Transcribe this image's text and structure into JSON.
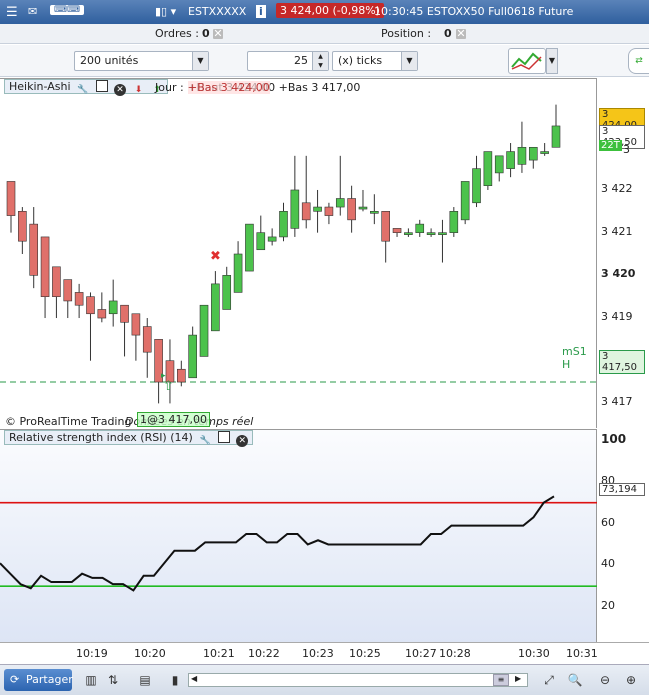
{
  "titlebar": {
    "instrument": "ESTXXXXX",
    "price_badge": "3 424,00 (-0,98%)",
    "info": "10:30:45 ESTOXX50 Full0618 Future",
    "info_icon": "i"
  },
  "ordersbar": {
    "orders_label": "Ordres :",
    "orders_value": "0",
    "position_label": "Position :",
    "position_value": "0"
  },
  "toolbar": {
    "quantity_select": "200 unités",
    "tick_value": "25",
    "tick_unit_select": "(x) ticks"
  },
  "price_panel": {
    "title": "Heikin-Ashi",
    "info_text": "Jour : +Haut 3 424,00 +Bas 3 417,00",
    "info_overlay": "+Bas 3 424,00",
    "copyright": "© ProRealTime Trading",
    "realtime": "Données en temps réel",
    "fill_label": "1@3 417,00",
    "ms1_label": "mS1 H",
    "axis_ticks": [
      "3 422",
      "3 421",
      "3 420",
      "3 419",
      "3 418",
      "3 417"
    ],
    "axis_tick_values": [
      3422,
      3421,
      3420,
      3419,
      3418,
      3417
    ],
    "axis_partial": "3",
    "badges": {
      "last_price": "3 424,00",
      "current": "3 423,50",
      "ticks_left": "22T",
      "ms1_value": "3 417,50"
    },
    "colors": {
      "up": "#4cc24c",
      "down": "#e0706a",
      "ms1": "#2a9a4a",
      "last": "#f5c518"
    }
  },
  "rsi_panel": {
    "title": "Relative strength index (RSI) (14)",
    "axis_ticks": [
      "100",
      "80",
      "60",
      "40",
      "20"
    ],
    "axis_tick_values": [
      100,
      80,
      60,
      40,
      20
    ],
    "current_badge": "73,194",
    "overbought": 70,
    "oversold": 30,
    "colors": {
      "line": "#111111",
      "overbought": "#dd1111",
      "oversold": "#22bb22"
    }
  },
  "time_axis": [
    "10:19",
    "10:20",
    "10:21",
    "10:22",
    "10:23",
    "10:25",
    "10:27",
    "10:28",
    "10:30",
    "10:31"
  ],
  "bottombar": {
    "share_label": "Partager",
    "icons": [
      "chart-type-icon",
      "indicator-icon",
      "draw-icon",
      "list-icon",
      "grid-icon",
      "settings-icon",
      "zoom-in-icon",
      "zoom-out-icon",
      "fit-icon"
    ]
  },
  "chart_data": {
    "type": "candlestick",
    "title": "Heikin-Ashi",
    "ylim": [
      3416.4,
      3424.6
    ],
    "candles": [
      {
        "o": 3422.2,
        "c": 3421.4,
        "h": 3422.2,
        "l": 3421.0
      },
      {
        "o": 3421.5,
        "c": 3420.8,
        "h": 3421.6,
        "l": 3420.5
      },
      {
        "o": 3421.2,
        "c": 3420.0,
        "h": 3421.6,
        "l": 3419.7
      },
      {
        "o": 3420.9,
        "c": 3419.5,
        "h": 3420.9,
        "l": 3419.0
      },
      {
        "o": 3420.2,
        "c": 3419.5,
        "h": 3420.2,
        "l": 3419.0
      },
      {
        "o": 3419.9,
        "c": 3419.4,
        "h": 3419.9,
        "l": 3419.0
      },
      {
        "o": 3419.6,
        "c": 3419.3,
        "h": 3419.8,
        "l": 3419.0
      },
      {
        "o": 3419.5,
        "c": 3419.1,
        "h": 3419.6,
        "l": 3418.0
      },
      {
        "o": 3419.2,
        "c": 3419.0,
        "h": 3419.6,
        "l": 3418.9
      },
      {
        "o": 3419.1,
        "c": 3419.4,
        "h": 3419.9,
        "l": 3418.8
      },
      {
        "o": 3419.3,
        "c": 3418.9,
        "h": 3419.3,
        "l": 3418.1
      },
      {
        "o": 3419.1,
        "c": 3418.6,
        "h": 3419.1,
        "l": 3418.0
      },
      {
        "o": 3418.8,
        "c": 3418.2,
        "h": 3419.0,
        "l": 3417.6
      },
      {
        "o": 3418.5,
        "c": 3417.5,
        "h": 3418.5,
        "l": 3417.0
      },
      {
        "o": 3418.0,
        "c": 3417.5,
        "h": 3418.5,
        "l": 3417.0
      },
      {
        "o": 3417.8,
        "c": 3417.5,
        "h": 3418.0,
        "l": 3417.4
      },
      {
        "o": 3417.6,
        "c": 3418.6,
        "h": 3418.8,
        "l": 3417.6
      },
      {
        "o": 3418.1,
        "c": 3419.3,
        "h": 3419.3,
        "l": 3418.1
      },
      {
        "o": 3418.7,
        "c": 3419.8,
        "h": 3420.1,
        "l": 3418.7
      },
      {
        "o": 3419.2,
        "c": 3420.0,
        "h": 3420.2,
        "l": 3419.2
      },
      {
        "o": 3419.6,
        "c": 3420.5,
        "h": 3420.8,
        "l": 3419.6
      },
      {
        "o": 3420.1,
        "c": 3421.2,
        "h": 3421.2,
        "l": 3420.1
      },
      {
        "o": 3420.6,
        "c": 3421.0,
        "h": 3421.4,
        "l": 3420.6
      },
      {
        "o": 3420.8,
        "c": 3420.9,
        "h": 3421.1,
        "l": 3420.7
      },
      {
        "o": 3420.9,
        "c": 3421.5,
        "h": 3421.7,
        "l": 3420.8
      },
      {
        "o": 3421.1,
        "c": 3422.0,
        "h": 3422.8,
        "l": 3420.9
      },
      {
        "o": 3421.7,
        "c": 3421.3,
        "h": 3422.8,
        "l": 3421.1
      },
      {
        "o": 3421.5,
        "c": 3421.6,
        "h": 3422.0,
        "l": 3421.0
      },
      {
        "o": 3421.6,
        "c": 3421.4,
        "h": 3421.7,
        "l": 3421.2
      },
      {
        "o": 3421.6,
        "c": 3421.8,
        "h": 3422.8,
        "l": 3421.4
      },
      {
        "o": 3421.8,
        "c": 3421.3,
        "h": 3422.1,
        "l": 3421.0
      },
      {
        "o": 3421.6,
        "c": 3421.6,
        "h": 3422.0,
        "l": 3421.5
      },
      {
        "o": 3421.5,
        "c": 3421.5,
        "h": 3421.9,
        "l": 3421.2
      },
      {
        "o": 3421.5,
        "c": 3420.8,
        "h": 3421.5,
        "l": 3420.3
      },
      {
        "o": 3421.1,
        "c": 3421.0,
        "h": 3421.1,
        "l": 3420.9
      },
      {
        "o": 3421.0,
        "c": 3421.0,
        "h": 3421.1,
        "l": 3420.9
      },
      {
        "o": 3421.0,
        "c": 3421.2,
        "h": 3421.3,
        "l": 3420.9
      },
      {
        "o": 3421.0,
        "c": 3421.0,
        "h": 3421.1,
        "l": 3420.9
      },
      {
        "o": 3421.0,
        "c": 3421.0,
        "h": 3421.3,
        "l": 3420.3
      },
      {
        "o": 3421.0,
        "c": 3421.5,
        "h": 3421.6,
        "l": 3420.9
      },
      {
        "o": 3421.3,
        "c": 3422.2,
        "h": 3422.2,
        "l": 3421.2
      },
      {
        "o": 3421.7,
        "c": 3422.5,
        "h": 3422.8,
        "l": 3421.6
      },
      {
        "o": 3422.1,
        "c": 3422.9,
        "h": 3422.9,
        "l": 3422.0
      },
      {
        "o": 3422.4,
        "c": 3422.8,
        "h": 3422.8,
        "l": 3422.2
      },
      {
        "o": 3422.5,
        "c": 3422.9,
        "h": 3423.1,
        "l": 3422.3
      },
      {
        "o": 3422.6,
        "c": 3423.0,
        "h": 3423.6,
        "l": 3422.4
      },
      {
        "o": 3422.7,
        "c": 3423.0,
        "h": 3423.0,
        "l": 3422.5
      },
      {
        "o": 3422.9,
        "c": 3422.9,
        "h": 3423.1,
        "l": 3422.8
      },
      {
        "o": 3423.0,
        "c": 3423.5,
        "h": 3424.0,
        "l": 3423.0
      }
    ],
    "ms1_level": 3417.5,
    "rsi": [
      41,
      36,
      31,
      29,
      35,
      32,
      32,
      32,
      36,
      34,
      34,
      31,
      31,
      28,
      35,
      35,
      41,
      47,
      47,
      47,
      51,
      51,
      51,
      51,
      55,
      55,
      51,
      51,
      55,
      55,
      50,
      52,
      50,
      50,
      50,
      50,
      50,
      50,
      50,
      50,
      50,
      50,
      55,
      55,
      59,
      59,
      59,
      59,
      59,
      59,
      59,
      59,
      63,
      70,
      73
    ]
  }
}
